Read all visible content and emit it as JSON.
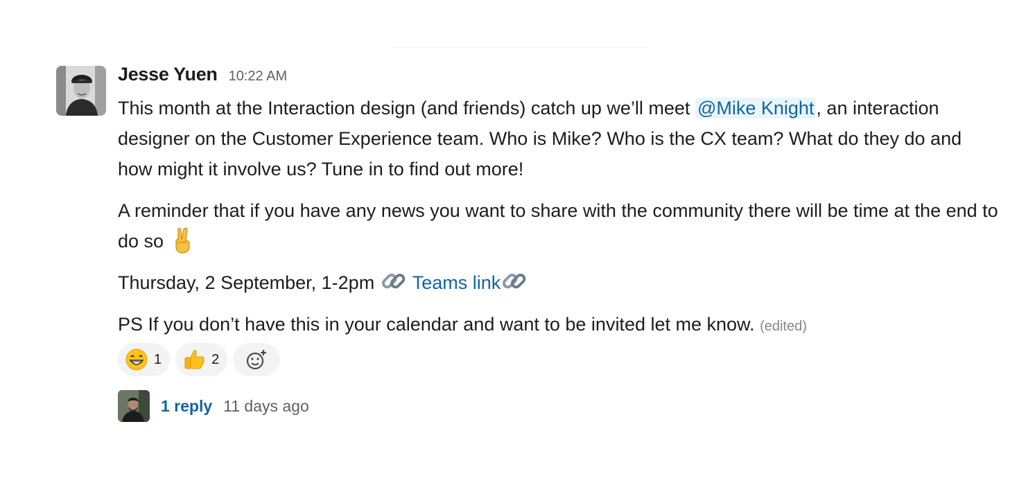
{
  "message": {
    "author": "Jesse Yuen",
    "timestamp": "10:22 AM",
    "paragraph1": {
      "before_mention": "This month at the Interaction design (and friends) catch up we’ll meet ",
      "mention": "@Mike Knight",
      "after_mention": ", an interaction designer on the Customer Experience team. Who is Mike? Who is the CX team? What do they do and how might it involve us? Tune in to find out more!"
    },
    "paragraph2": {
      "text": "A reminder that if you have any news you want to share with the community there will be time at the end to do so ",
      "emoji": "victory-hand"
    },
    "paragraph3": {
      "date_text": "Thursday, 2 September, 1-2pm",
      "link_text": "Teams link",
      "emoji": "link"
    },
    "paragraph4": {
      "text": "PS If you don’t have this in your calendar and want to be invited let me know.",
      "edited_label": "(edited)"
    }
  },
  "reactions": [
    {
      "emoji": "grinning-face-with-smiling-eyes",
      "count": "1"
    },
    {
      "emoji": "thumbs-up",
      "count": "2"
    }
  ],
  "add_reaction_icon": "add-emoji-icon",
  "thread": {
    "reply_count": "1 reply",
    "last_reply": "11 days ago"
  },
  "colors": {
    "link": "#1264a3",
    "mention_bg": "#e8f5fa",
    "reaction_bg": "#f3f3f3",
    "muted": "#616061"
  }
}
